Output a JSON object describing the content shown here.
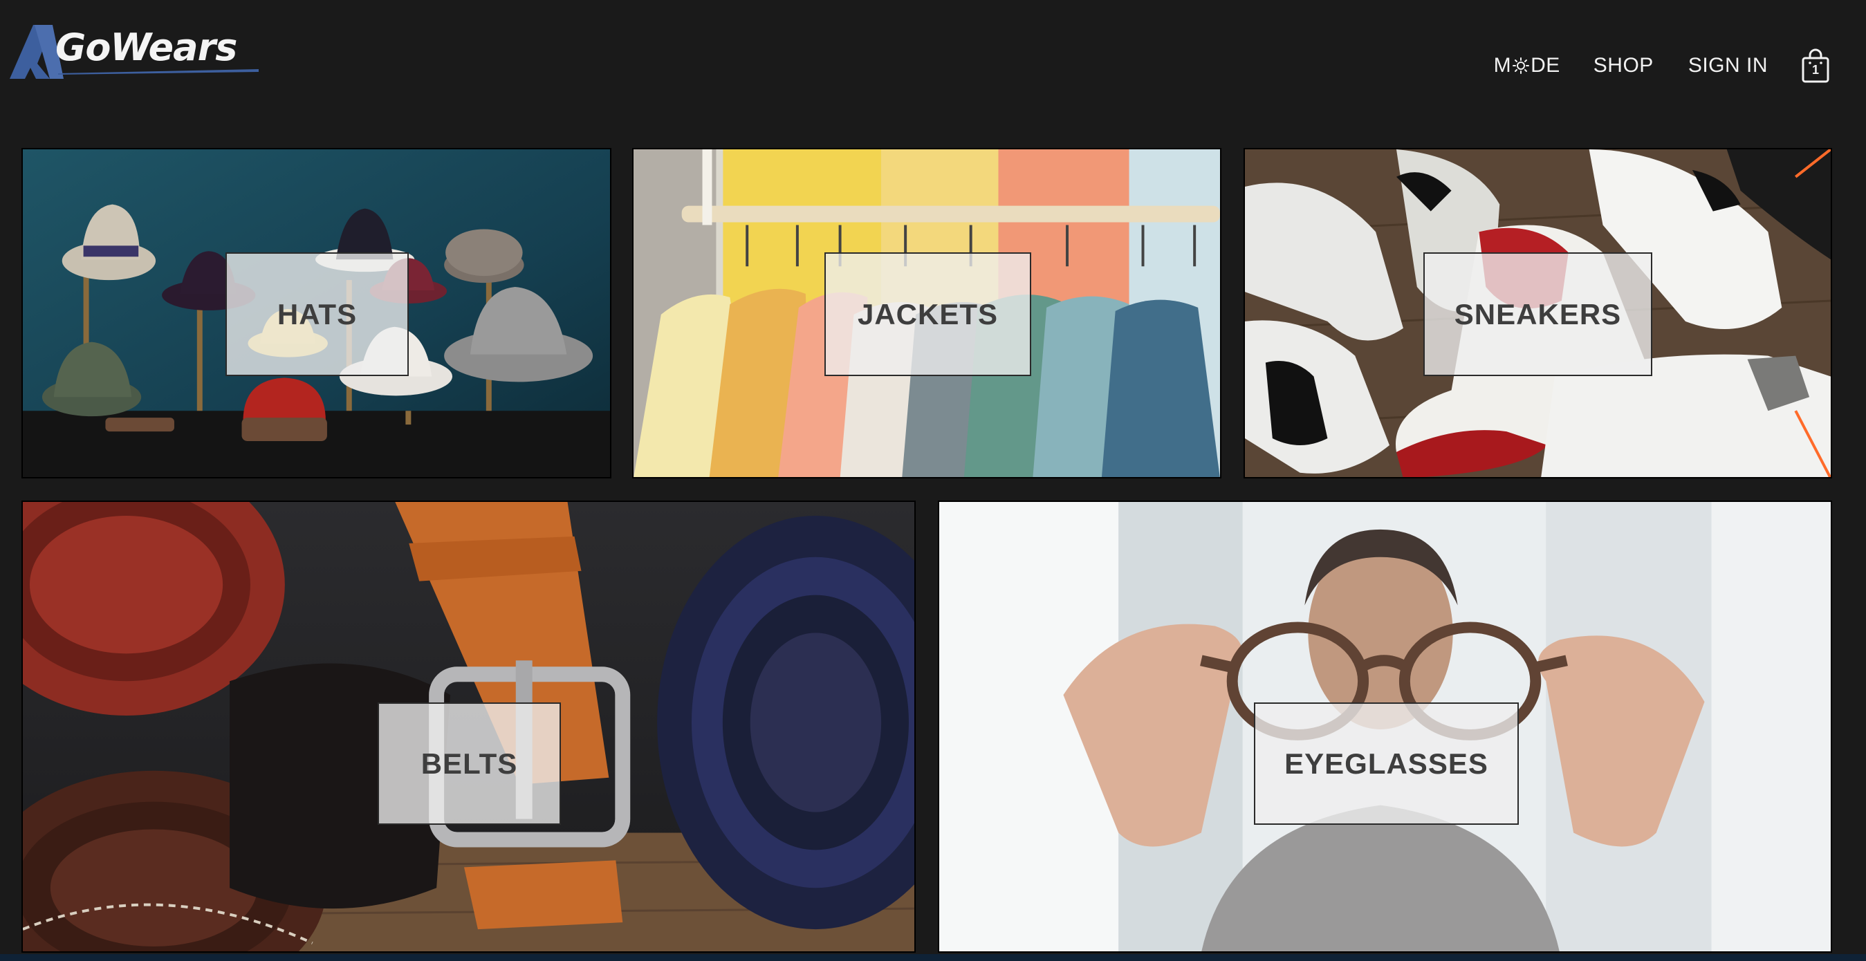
{
  "brand": {
    "name": "GoWears",
    "accent": "#3d5f9e"
  },
  "nav": {
    "mode_prefix": "M",
    "mode_suffix": "DE",
    "shop": "SHOP",
    "sign_in": "SIGN IN",
    "cart_count": "1"
  },
  "categories": [
    {
      "label": "HATS"
    },
    {
      "label": "JACKETS"
    },
    {
      "label": "SNEAKERS"
    },
    {
      "label": "BELTS"
    },
    {
      "label": "EYEGLASSES"
    }
  ],
  "colors": {
    "page_bg": "#1a1a1a",
    "label_bg": "#eeeeee",
    "label_text": "#3e3e3e"
  }
}
